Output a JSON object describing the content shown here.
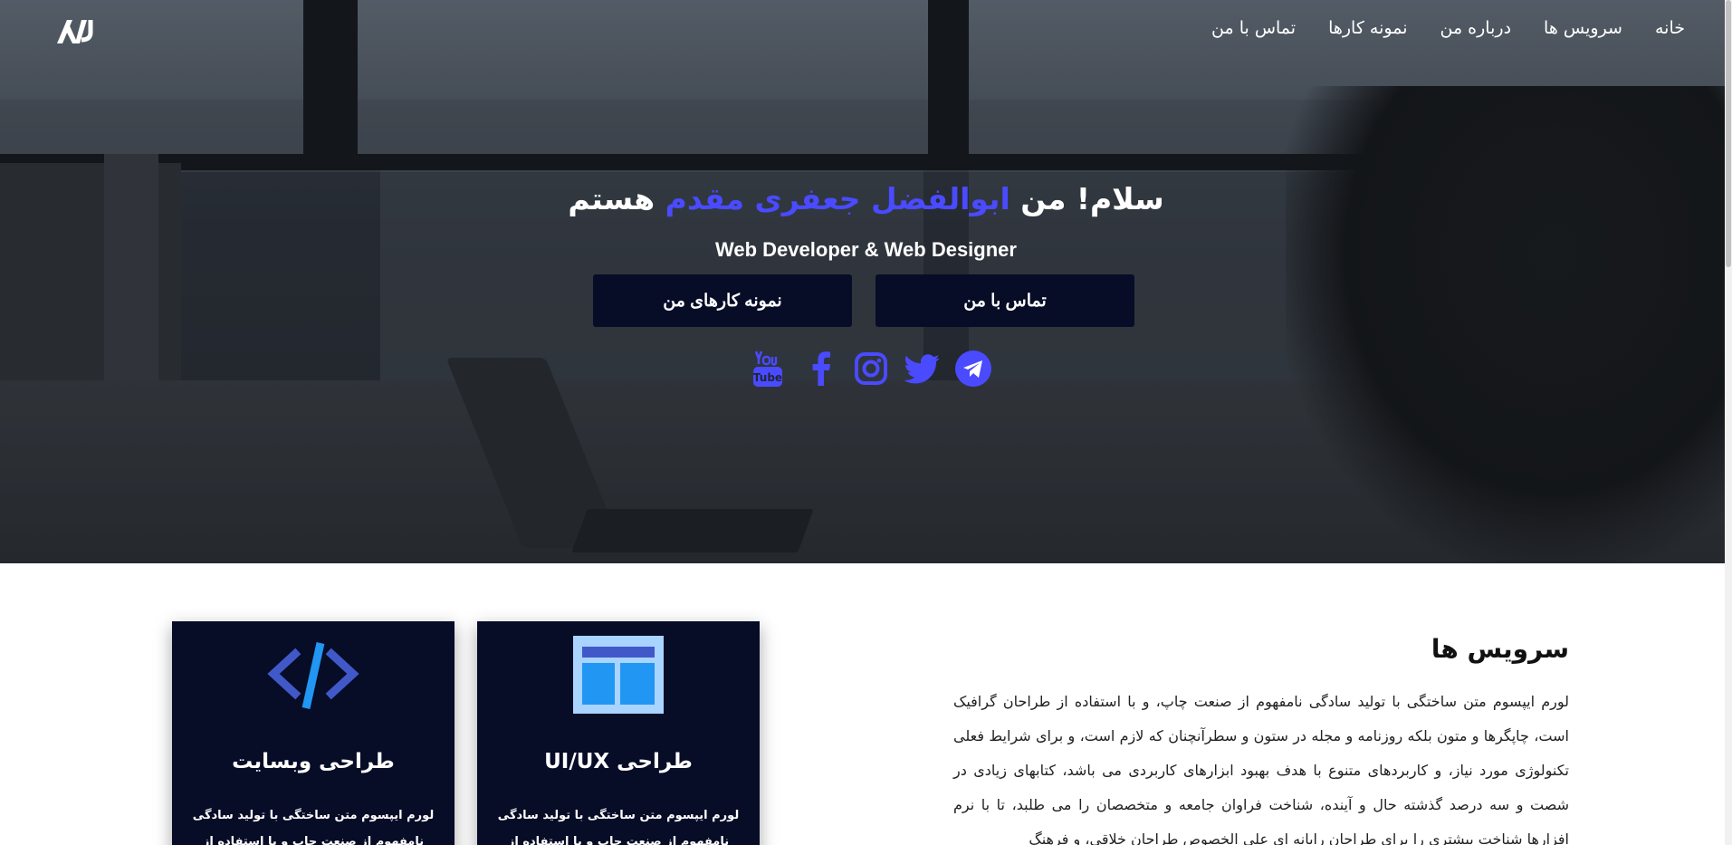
{
  "nav": {
    "logo_alt": "AJ",
    "links": [
      {
        "label": "خانه"
      },
      {
        "label": "سرویس ها"
      },
      {
        "label": "درباره من"
      },
      {
        "label": "نمونه کارها"
      },
      {
        "label": "تماس با من"
      }
    ]
  },
  "hero": {
    "title_before": "سلام! من ",
    "title_name": "ابوالفضل جعفری مقدم",
    "title_after": " هستم",
    "subtitle": "Web Developer & Web Designer",
    "btn_contact": "تماس با من",
    "btn_portfolio": "نمونه کارهای من",
    "socials": [
      "telegram-icon",
      "twitter-icon",
      "instagram-icon",
      "facebook-icon",
      "youtube-icon"
    ],
    "accent_color": "#4a4aff"
  },
  "services": {
    "title": "سرویس ها",
    "text": "لورم ایپسوم متن ساختگی با تولید سادگی نامفهوم از صنعت چاپ، و با استفاده از طراحان گرافیک است، چاپگرها و متون بلکه روزنامه و مجله در ستون و سطرآنچنان که لازم است، و برای شرایط فعلی تکنولوژی مورد نیاز، و کاربردهای متنوع با هدف بهبود ابزارهای کاربردی می باشد، کتابهای زیادی در شصت و سه درصد گذشته حال و آینده، شناخت فراوان جامعه و متخصصان را می طلبد، تا با نرم افزارها شناخت بیشتری را برای طراحان رایانه ای علی الخصوص طراحان خلاقی، و فرهنگ",
    "cards": [
      {
        "title": "طراحی UI/UX",
        "text": "لورم ایپسوم متن ساختگی با تولید سادگی نامفهوم از صنعت چاپ و با استفاده از طراحان گرافیک است"
      },
      {
        "title": "طراحی وبسایت",
        "text": "لورم ایپسوم متن ساختگی با تولید سادگی نامفهوم از صنعت چاپ و با استفاده از طراحان گرافیک است"
      }
    ],
    "card_bg": "#070c27"
  }
}
